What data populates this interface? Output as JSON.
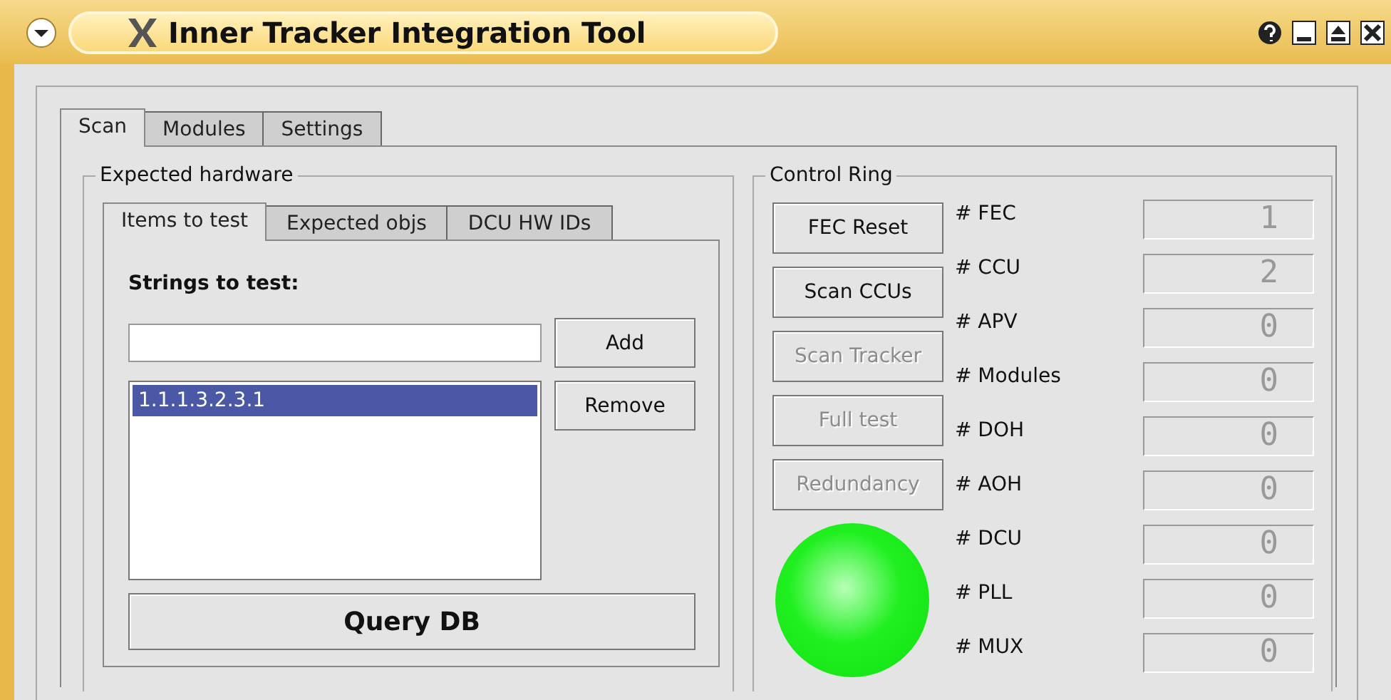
{
  "window": {
    "title": "Inner Tracker Integration Tool"
  },
  "tabs": [
    {
      "label": "Scan",
      "selected": true
    },
    {
      "label": "Modules",
      "selected": false
    },
    {
      "label": "Settings",
      "selected": false
    }
  ],
  "expected_hardware": {
    "title": "Expected hardware",
    "tabs": [
      {
        "label": "Items to test",
        "selected": true
      },
      {
        "label": "Expected objs",
        "selected": false
      },
      {
        "label": "DCU HW IDs",
        "selected": false
      }
    ],
    "strings_label": "Strings to test:",
    "items": [
      {
        "text": "1.1.1.3.2.3.1",
        "selected": true
      }
    ],
    "add_button": "Add",
    "remove_button": "Remove",
    "query_button": "Query DB"
  },
  "control_ring": {
    "title": "Control Ring",
    "buttons": [
      {
        "label": "FEC Reset",
        "disabled": false
      },
      {
        "label": "Scan CCUs",
        "disabled": false
      },
      {
        "label": "Scan Tracker",
        "disabled": true
      },
      {
        "label": "Full test",
        "disabled": true
      },
      {
        "label": "Redundancy",
        "disabled": true
      }
    ],
    "led": {
      "on": true
    },
    "counters": [
      {
        "label": "# FEC",
        "value": "1"
      },
      {
        "label": "# CCU",
        "value": "2"
      },
      {
        "label": "# APV",
        "value": "0"
      },
      {
        "label": "# Modules",
        "value": "0"
      },
      {
        "label": "# DOH",
        "value": "0"
      },
      {
        "label": "# AOH",
        "value": "0"
      },
      {
        "label": "# DCU",
        "value": "0"
      },
      {
        "label": "# PLL",
        "value": "0"
      },
      {
        "label": "# MUX",
        "value": "0"
      }
    ]
  }
}
